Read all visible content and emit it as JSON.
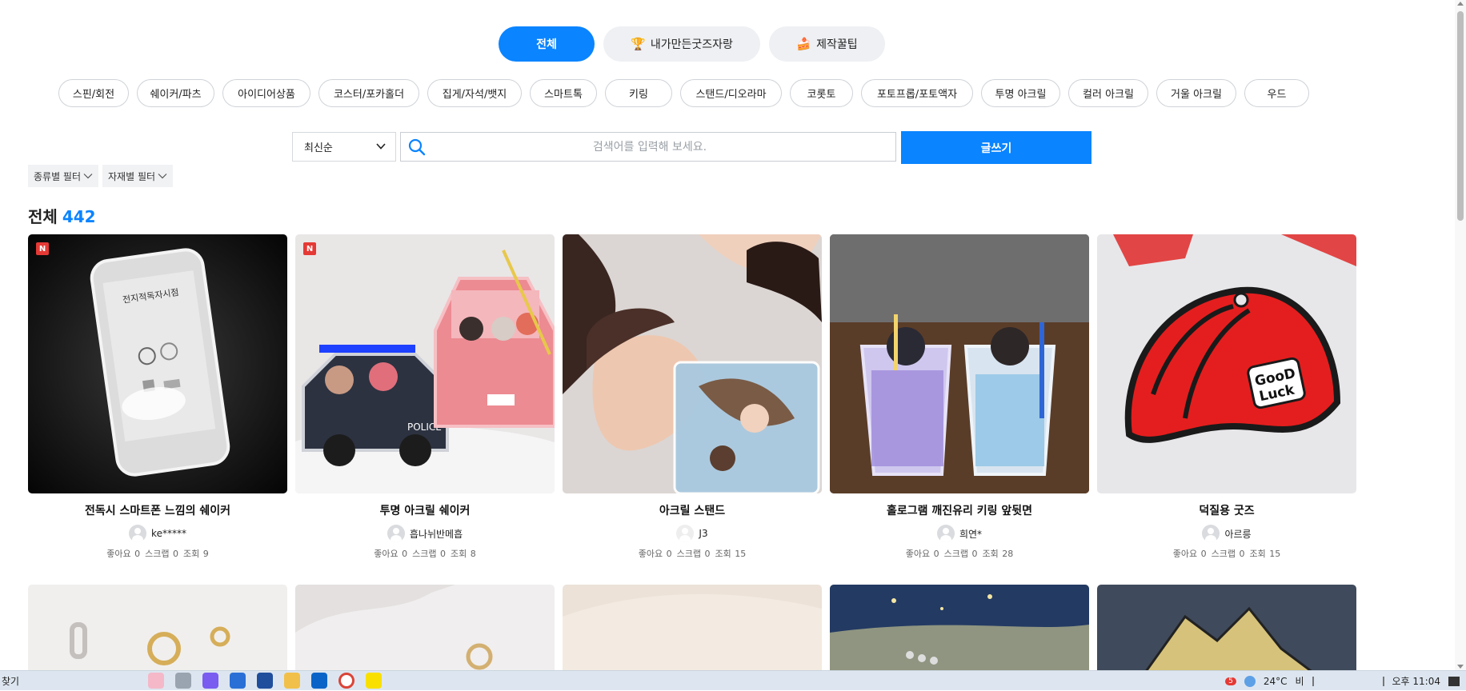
{
  "top_tabs": [
    {
      "label": "전체",
      "icon": "",
      "active": true
    },
    {
      "label": "내가만든굿즈자랑",
      "icon": "🏆",
      "active": false
    },
    {
      "label": "제작꿀팁",
      "icon": "🍰",
      "active": false
    }
  ],
  "subcategories": [
    "스핀/회전",
    "쉐이커/파츠",
    "아이디어상품",
    "코스터/포카홀더",
    "집게/자석/뱃지",
    "스마트톡",
    "키링",
    "스탠드/디오라마",
    "코롯토",
    "포토프롭/포토액자",
    "투명 아크릴",
    "컬러 아크릴",
    "거울 아크릴",
    "우드"
  ],
  "sort": {
    "selected": "최신순"
  },
  "search": {
    "placeholder": "검색어를 입력해 보세요.",
    "value": ""
  },
  "write_button": "글쓰기",
  "filters": [
    "종류별 필터",
    "자재별 필터"
  ],
  "heading": {
    "label": "전체",
    "count": "442"
  },
  "cards": [
    {
      "title": "전독시 스마트폰 느낌의 쉐이커",
      "author": "ke*****",
      "likes": "좋아요 0",
      "scraps": "스크랩 0",
      "views": "조회 9",
      "is_new": true,
      "badge": "N"
    },
    {
      "title": "투명 아크릴 쉐이커",
      "author": "흡나뉘반메흡",
      "likes": "좋아요 0",
      "scraps": "스크랩 0",
      "views": "조회 8",
      "is_new": true,
      "badge": "N"
    },
    {
      "title": "아크릴 스탠드",
      "author": "J3",
      "likes": "좋아요 0",
      "scraps": "스크랩 0",
      "views": "조회 15",
      "is_new": false
    },
    {
      "title": "홀로그램 깨진유리 키링 앞뒷면",
      "author": "희연*",
      "likes": "좋아요 0",
      "scraps": "스크랩 0",
      "views": "조회 28",
      "is_new": false
    },
    {
      "title": "덕질용 굿즈",
      "author": "아르릉",
      "likes": "좋아요 0",
      "scraps": "스크랩 0",
      "views": "조회 15",
      "is_new": false
    }
  ],
  "taskbar": {
    "search_label": "찾기",
    "weather": "24°C",
    "weather_extra": "비",
    "time": "오후 11:04",
    "notification_count": "5"
  },
  "colors": {
    "accent": "#0a84ff",
    "badge_red": "#e53935",
    "tab_bg": "#eef0f3"
  }
}
